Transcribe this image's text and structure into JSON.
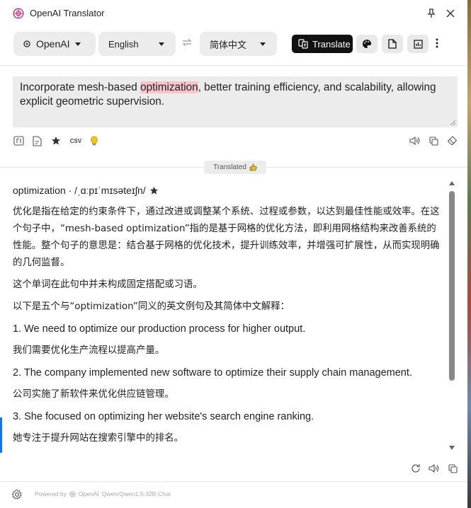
{
  "window": {
    "title": "OpenAI Translator",
    "pin_icon": "pin-icon",
    "close_icon": "close-icon"
  },
  "toolbar": {
    "service": "OpenAI",
    "source_language": "English",
    "target_language": "简体中文",
    "translate_label": "Translate",
    "swap_icon": "swap-icon"
  },
  "input": {
    "text_before": "Incorporate mesh-based ",
    "highlight": "optimization",
    "text_after": ", better training efficiency, and scalability, allowing explicit geometric supervision.",
    "tools": [
      "ocr-icon",
      "document-icon",
      "star-icon",
      "csv-icon",
      "lightbulb-icon"
    ],
    "csv_label": "CSV"
  },
  "badge": {
    "label": "Translated",
    "icon": "thumbs-up-icon"
  },
  "output": {
    "headword": "optimization · /ˌɑːpɪˈmɪsəteɪʃn/",
    "paragraphs": [
      {
        "lang": "zh",
        "text": "优化是指在给定的约束条件下，通过改进或调整某个系统、过程或参数，以达到最佳性能或效率。在这个句子中，“mesh-based optimization”指的是基于网格的优化方法，即利用网格结构来改善系统的性能。整个句子的意思是：结合基于网格的优化技术，提升训练效率，并增强可扩展性，从而实现明确的几何监督。"
      },
      {
        "lang": "zh",
        "text": "这个单词在此句中并未构成固定搭配或习语。"
      },
      {
        "lang": "zh",
        "text": "以下是五个与“optimization”同义的英文例句及其简体中文解释："
      },
      {
        "lang": "en",
        "text": "1. We need to optimize our production process for higher output."
      },
      {
        "lang": "zh",
        "text": "我们需要优化生产流程以提高产量。"
      },
      {
        "lang": "en",
        "text": "2. The company implemented new software to optimize their supply chain management."
      },
      {
        "lang": "zh",
        "text": "公司实施了新软件来优化供应链管理。"
      },
      {
        "lang": "en",
        "text": "3. She focused on optimizing her website's search engine ranking."
      },
      {
        "lang": "zh",
        "text": "她专注于提升网站在搜索引擎中的排名。"
      }
    ]
  },
  "footer": {
    "powered_by": "Powered by",
    "provider": "OpenAI",
    "model": "Qwen/Qwen1.5-32B-Chat"
  },
  "colors": {
    "highlight": "#f7c6cc",
    "translate_button": "#111111",
    "panel": "#ececec",
    "accent": "#1a73e8"
  }
}
